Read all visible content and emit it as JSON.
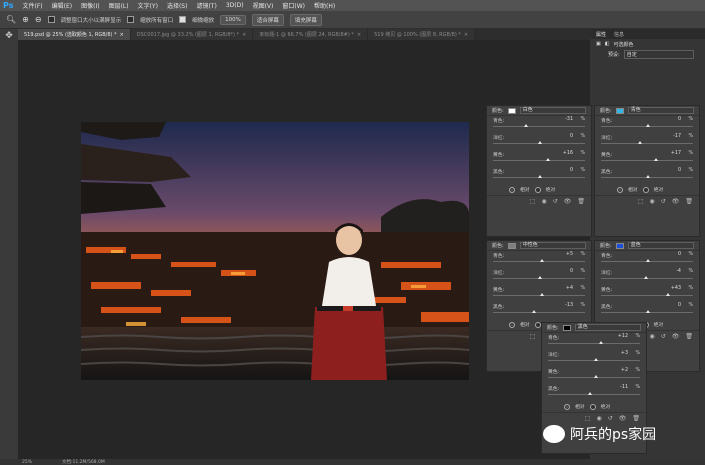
{
  "app": {
    "logo": "Ps"
  },
  "menu": [
    "文件(F)",
    "编辑(E)",
    "图像(I)",
    "图层(L)",
    "文字(Y)",
    "选择(S)",
    "滤镜(T)",
    "3D(D)",
    "视图(V)",
    "窗口(W)",
    "帮助(H)"
  ],
  "options": {
    "opt1": "调整窗口大小以满屏显示",
    "opt2": "缩放所有窗口",
    "opt3": "细微缩放",
    "zoom_btn": "100%",
    "fit_btn": "适合屏幕",
    "fill_btn": "填充屏幕"
  },
  "tabs": [
    {
      "label": "519.psd @ 25% (选取颜色 1, RGB/8) *",
      "active": true
    },
    {
      "label": "DSC0017.jpg @ 33.2% (图层 1, RGB/8*) *",
      "active": false
    },
    {
      "label": "未标题-1 @ 66.7% (图层 24, RGB/8#) *",
      "active": false
    },
    {
      "label": "519 拷贝 @ 100% (图层 8, RGB/8) *",
      "active": false
    }
  ],
  "panel_tabs": [
    "属性",
    "信息"
  ],
  "props_title": "可选颜色",
  "preset_label": "预设:",
  "preset_value": "自定",
  "color_label": "颜色:",
  "abs_label": "相对",
  "abs_label2": "绝对",
  "panels": {
    "white": {
      "color": "白色",
      "swatch": "#ffffff",
      "rows": [
        {
          "label": "青色:",
          "value": "-31",
          "pos": 0.35
        },
        {
          "label": "洋红:",
          "value": "0",
          "pos": 0.5
        },
        {
          "label": "黄色:",
          "value": "+16",
          "pos": 0.58
        },
        {
          "label": "黑色:",
          "value": "0",
          "pos": 0.5
        }
      ]
    },
    "cyan": {
      "color": "青色",
      "swatch": "#2fb7e8",
      "rows": [
        {
          "label": "青色:",
          "value": "0",
          "pos": 0.5
        },
        {
          "label": "洋红:",
          "value": "-17",
          "pos": 0.42
        },
        {
          "label": "黄色:",
          "value": "+17",
          "pos": 0.58
        },
        {
          "label": "黑色:",
          "value": "0",
          "pos": 0.5
        }
      ]
    },
    "neutral": {
      "color": "中性色",
      "swatch": "#808080",
      "rows": [
        {
          "label": "青色:",
          "value": "+5",
          "pos": 0.52
        },
        {
          "label": "洋红:",
          "value": "0",
          "pos": 0.5
        },
        {
          "label": "黄色:",
          "value": "+4",
          "pos": 0.52
        },
        {
          "label": "黑色:",
          "value": "-13",
          "pos": 0.44
        }
      ]
    },
    "blue": {
      "color": "蓝色",
      "swatch": "#1e4fd8",
      "rows": [
        {
          "label": "青色:",
          "value": "0",
          "pos": 0.5
        },
        {
          "label": "洋红:",
          "value": "-4",
          "pos": 0.48
        },
        {
          "label": "黄色:",
          "value": "+43",
          "pos": 0.71
        },
        {
          "label": "黑色:",
          "value": "0",
          "pos": 0.5
        }
      ]
    },
    "black": {
      "color": "黑色",
      "swatch": "#000000",
      "rows": [
        {
          "label": "青色:",
          "value": "+12",
          "pos": 0.56
        },
        {
          "label": "洋红:",
          "value": "+3",
          "pos": 0.51
        },
        {
          "label": "黄色:",
          "value": "+2",
          "pos": 0.51
        },
        {
          "label": "黑色:",
          "value": "-11",
          "pos": 0.45
        }
      ]
    }
  },
  "status": {
    "zoom": "25%",
    "doc": "文档:11.2M/568.0M"
  },
  "watermark": "阿兵的ps家园"
}
